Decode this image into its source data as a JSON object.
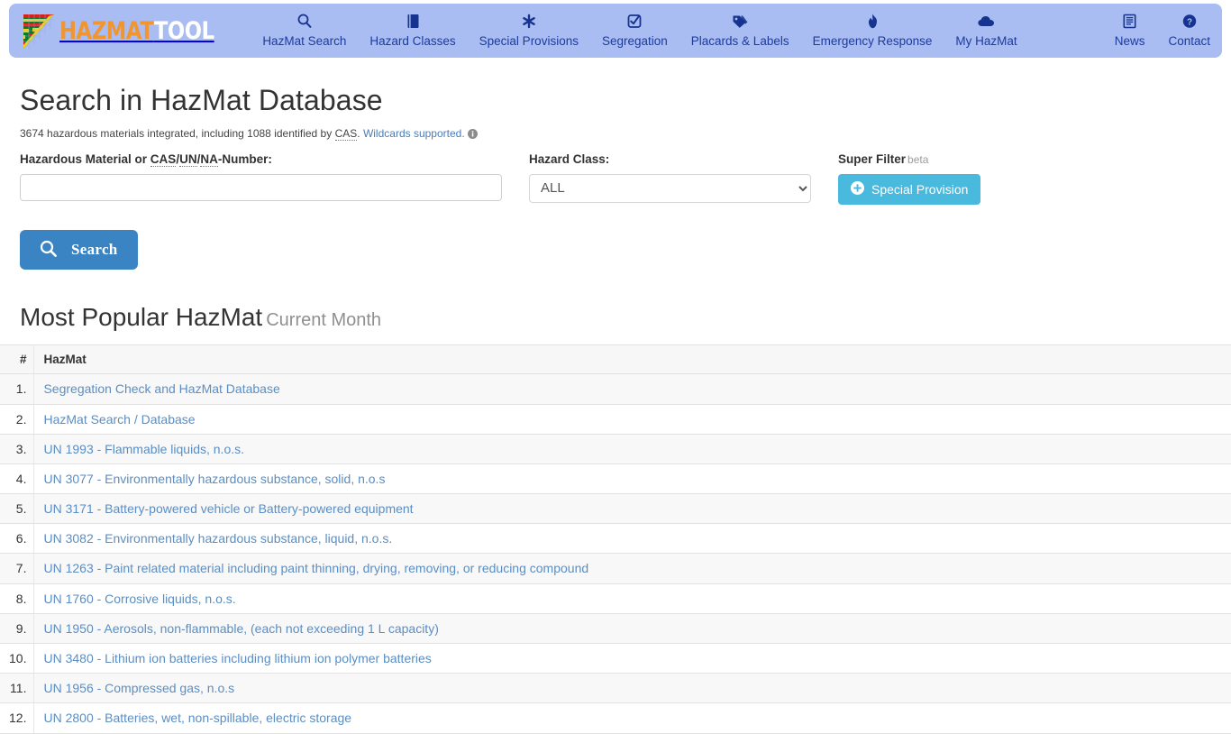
{
  "navbar": {
    "brand": {
      "primary": "HAZMAT",
      "secondary": "TOOL",
      "logo_alt": "hazmat-flag-logo"
    },
    "background_color": "#aabdf2",
    "link_color": "#1a3ba0",
    "items": [
      {
        "label": "HazMat Search",
        "icon": "search-icon"
      },
      {
        "label": "Hazard Classes",
        "icon": "book-icon"
      },
      {
        "label": "Special Provisions",
        "icon": "asterisk-icon"
      },
      {
        "label": "Segregation",
        "icon": "check-square-icon"
      },
      {
        "label": "Placards & Labels",
        "icon": "tags-icon"
      },
      {
        "label": "Emergency Response",
        "icon": "fire-icon"
      },
      {
        "label": "My HazMat",
        "icon": "cloud-icon"
      }
    ],
    "right_items": [
      {
        "label": "News",
        "icon": "newspaper-icon"
      },
      {
        "label": "Contact",
        "icon": "question-circle-icon"
      }
    ]
  },
  "search": {
    "title": "Search in HazMat Database",
    "subtitle_part1": "3674 hazardous materials integrated, including 1088 identified by ",
    "subtitle_abbr": "CAS",
    "subtitle_part2": ". ",
    "subtitle_link": "Wildcards supported.",
    "info_icon": "info-circle-icon",
    "hazmat_label_part1": "Hazardous Material or ",
    "hazmat_label_abbr1": "CAS",
    "hazmat_label_sep1": "/",
    "hazmat_label_abbr2": "UN",
    "hazmat_label_sep2": "/",
    "hazmat_label_abbr3": "NA",
    "hazmat_label_part2": "-Number:",
    "hazmat_input_value": "",
    "hazmat_input_placeholder": "",
    "class_label": "Hazard Class:",
    "class_selected": "ALL",
    "class_options": [
      "ALL"
    ],
    "super_filter_label": "Super Filter",
    "super_filter_beta": "beta",
    "special_provision_label": "Special Provision",
    "special_provision_icon": "plus-circle-icon",
    "special_provision_color": "#49b9dd",
    "search_button_label": "Search",
    "search_button_icon": "search-icon",
    "search_button_color": "#3a84c3"
  },
  "popular": {
    "title": "Most Popular HazMat",
    "subtitle": "Current Month",
    "columns": [
      "#",
      "HazMat"
    ],
    "rows": [
      {
        "num": "1.",
        "name": "Segregation Check and HazMat Database"
      },
      {
        "num": "2.",
        "name": "HazMat Search / Database"
      },
      {
        "num": "3.",
        "name": "UN 1993 - Flammable liquids, n.o.s."
      },
      {
        "num": "4.",
        "name": "UN 3077 - Environmentally hazardous substance, solid, n.o.s"
      },
      {
        "num": "5.",
        "name": "UN 3171 - Battery-powered vehicle or Battery-powered equipment"
      },
      {
        "num": "6.",
        "name": "UN 3082 - Environmentally hazardous substance, liquid, n.o.s."
      },
      {
        "num": "7.",
        "name": "UN 1263 - Paint related material including paint thinning, drying, removing, or reducing compound"
      },
      {
        "num": "8.",
        "name": "UN 1760 - Corrosive liquids, n.o.s."
      },
      {
        "num": "9.",
        "name": "UN 1950 - Aerosols, non-flammable, (each not exceeding 1 L capacity)"
      },
      {
        "num": "10.",
        "name": "UN 3480 - Lithium ion batteries including lithium ion polymer batteries"
      },
      {
        "num": "11.",
        "name": "UN 1956 - Compressed gas, n.o.s"
      },
      {
        "num": "12.",
        "name": "UN 2800 - Batteries, wet, non-spillable, electric storage"
      }
    ]
  }
}
